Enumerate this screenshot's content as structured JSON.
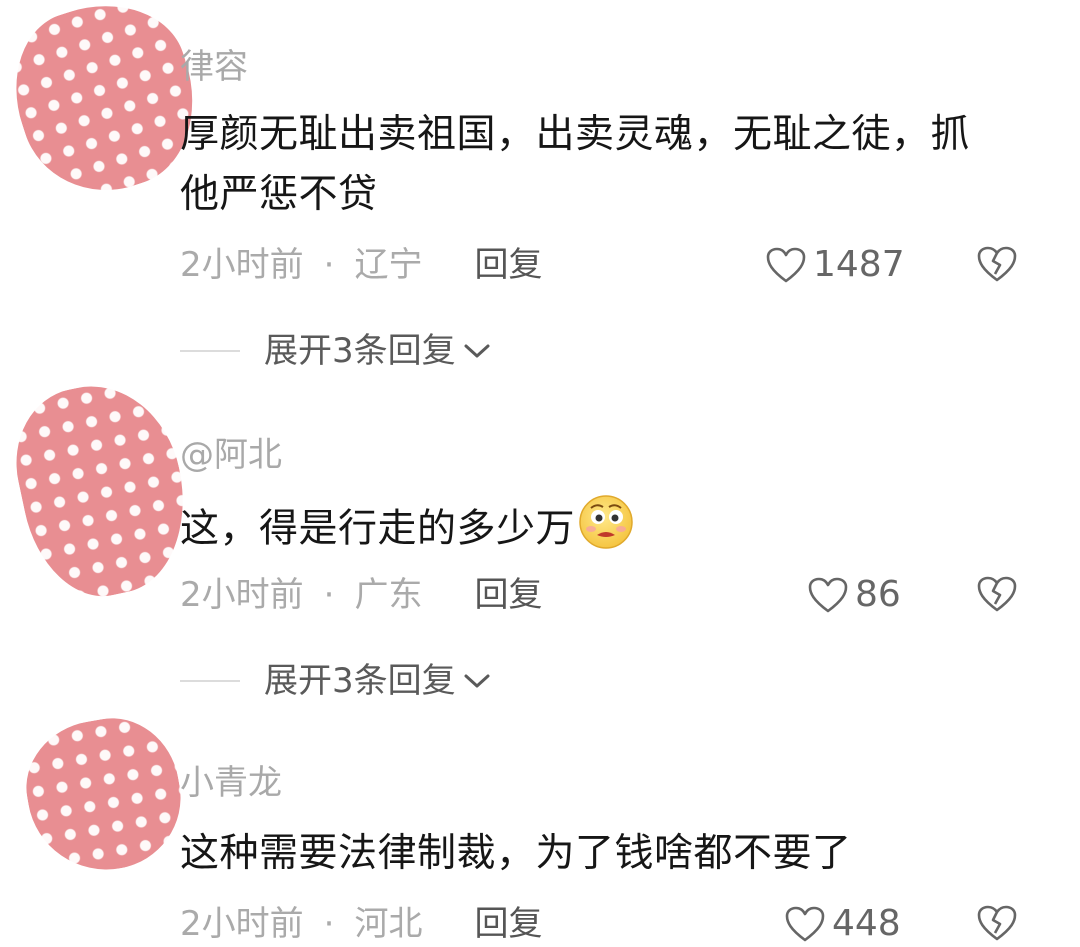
{
  "comments": [
    {
      "username": "律容",
      "text": "厚颜无耻出卖祖国，出卖灵魂，无耻之徒，抓他严惩不贷",
      "time": "2小时前",
      "separator": "·",
      "location": "辽宁",
      "reply_label": "回复",
      "likes": "1487",
      "expand_label": "展开3条回复"
    },
    {
      "username": "@阿北",
      "text": "这，得是行走的多少万",
      "emoji": "worried-face-emoji",
      "time": "2小时前",
      "separator": "·",
      "location": "广东",
      "reply_label": "回复",
      "likes": "86",
      "expand_label": "展开3条回复"
    },
    {
      "username": "小青龙",
      "text": "这种需要法律制裁，为了钱啥都不要了",
      "time": "2小时前",
      "separator": "·",
      "location": "河北",
      "reply_label": "回复",
      "likes": "448"
    }
  ],
  "icons": {
    "like": "heart-outline-icon",
    "dislike": "broken-heart-icon",
    "expand": "chevron-down-icon"
  },
  "colors": {
    "avatar_mask": "#e88e92",
    "username": "#a9a9a9",
    "body_text": "#161616",
    "meta_text": "#aaaaaa"
  }
}
